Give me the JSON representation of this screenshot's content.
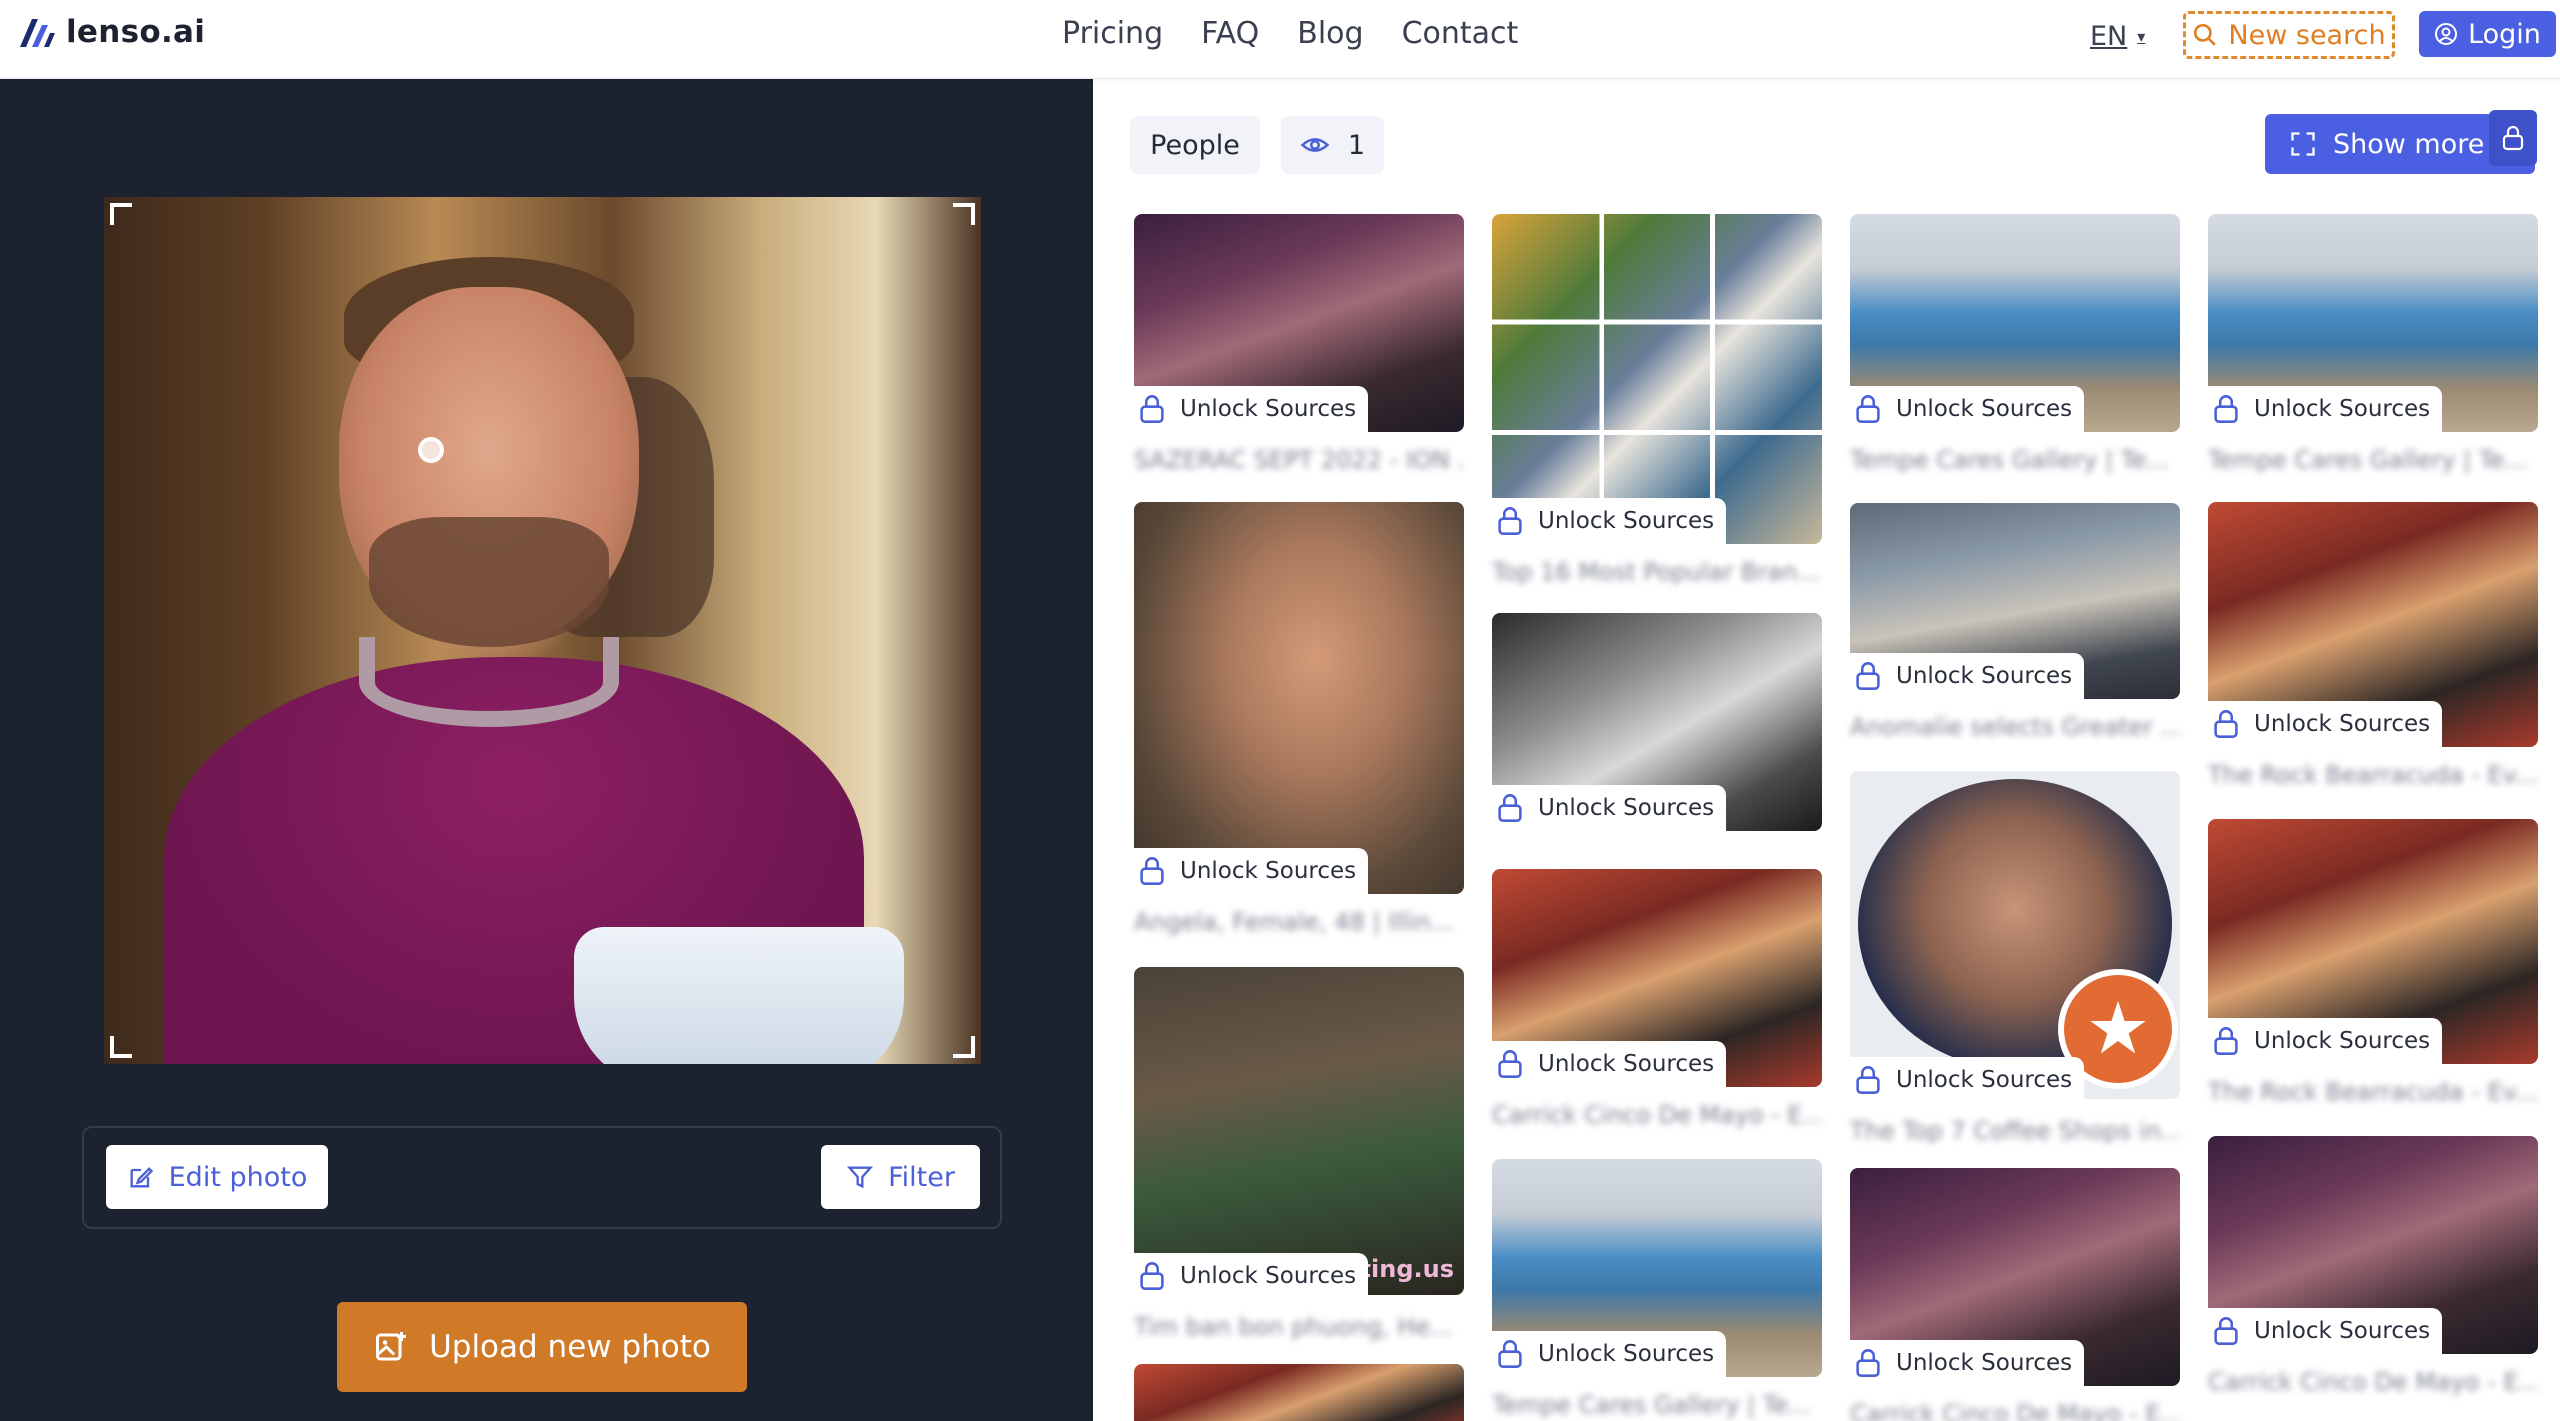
{
  "header": {
    "logo_text": "lenso.ai",
    "nav": [
      "Pricing",
      "FAQ",
      "Blog",
      "Contact"
    ],
    "lang": "EN",
    "new_search": "New search",
    "login": "Login"
  },
  "left": {
    "edit_photo": "Edit photo",
    "filter": "Filter",
    "upload": "Upload new photo"
  },
  "results": {
    "people_tab": "People",
    "views_count": "1",
    "show_more": "Show more",
    "unlock_label": "Unlock Sources",
    "captions": [
      "SAZERAC SEPT 2022 - ION ...",
      "Angela, Female, 48 | Illin...",
      "Tim ban bon phuong, He...",
      "Top 16 Most Popular Bran...",
      "Carrick Cinco De Mayo - E...",
      "Tempe Cares Gallery | Te...",
      "Tempe Cares Gallery | Te...",
      "Anomalie selects Greater ...",
      "The Top 7 Coffee Shops in...",
      "Carrick Cinco De Mayo - E...",
      "Tempe Cares Gallery | Te...",
      "The Rock Bearracuda - Ev...",
      "The Rock Bearracuda - Ev...",
      "Carrick Cinco De Mayo - E..."
    ],
    "watermark": "lating.us"
  },
  "colors": {
    "accent": "#4a5fe2",
    "orange": "#d07a28",
    "dark_panel": "#1d2230"
  }
}
